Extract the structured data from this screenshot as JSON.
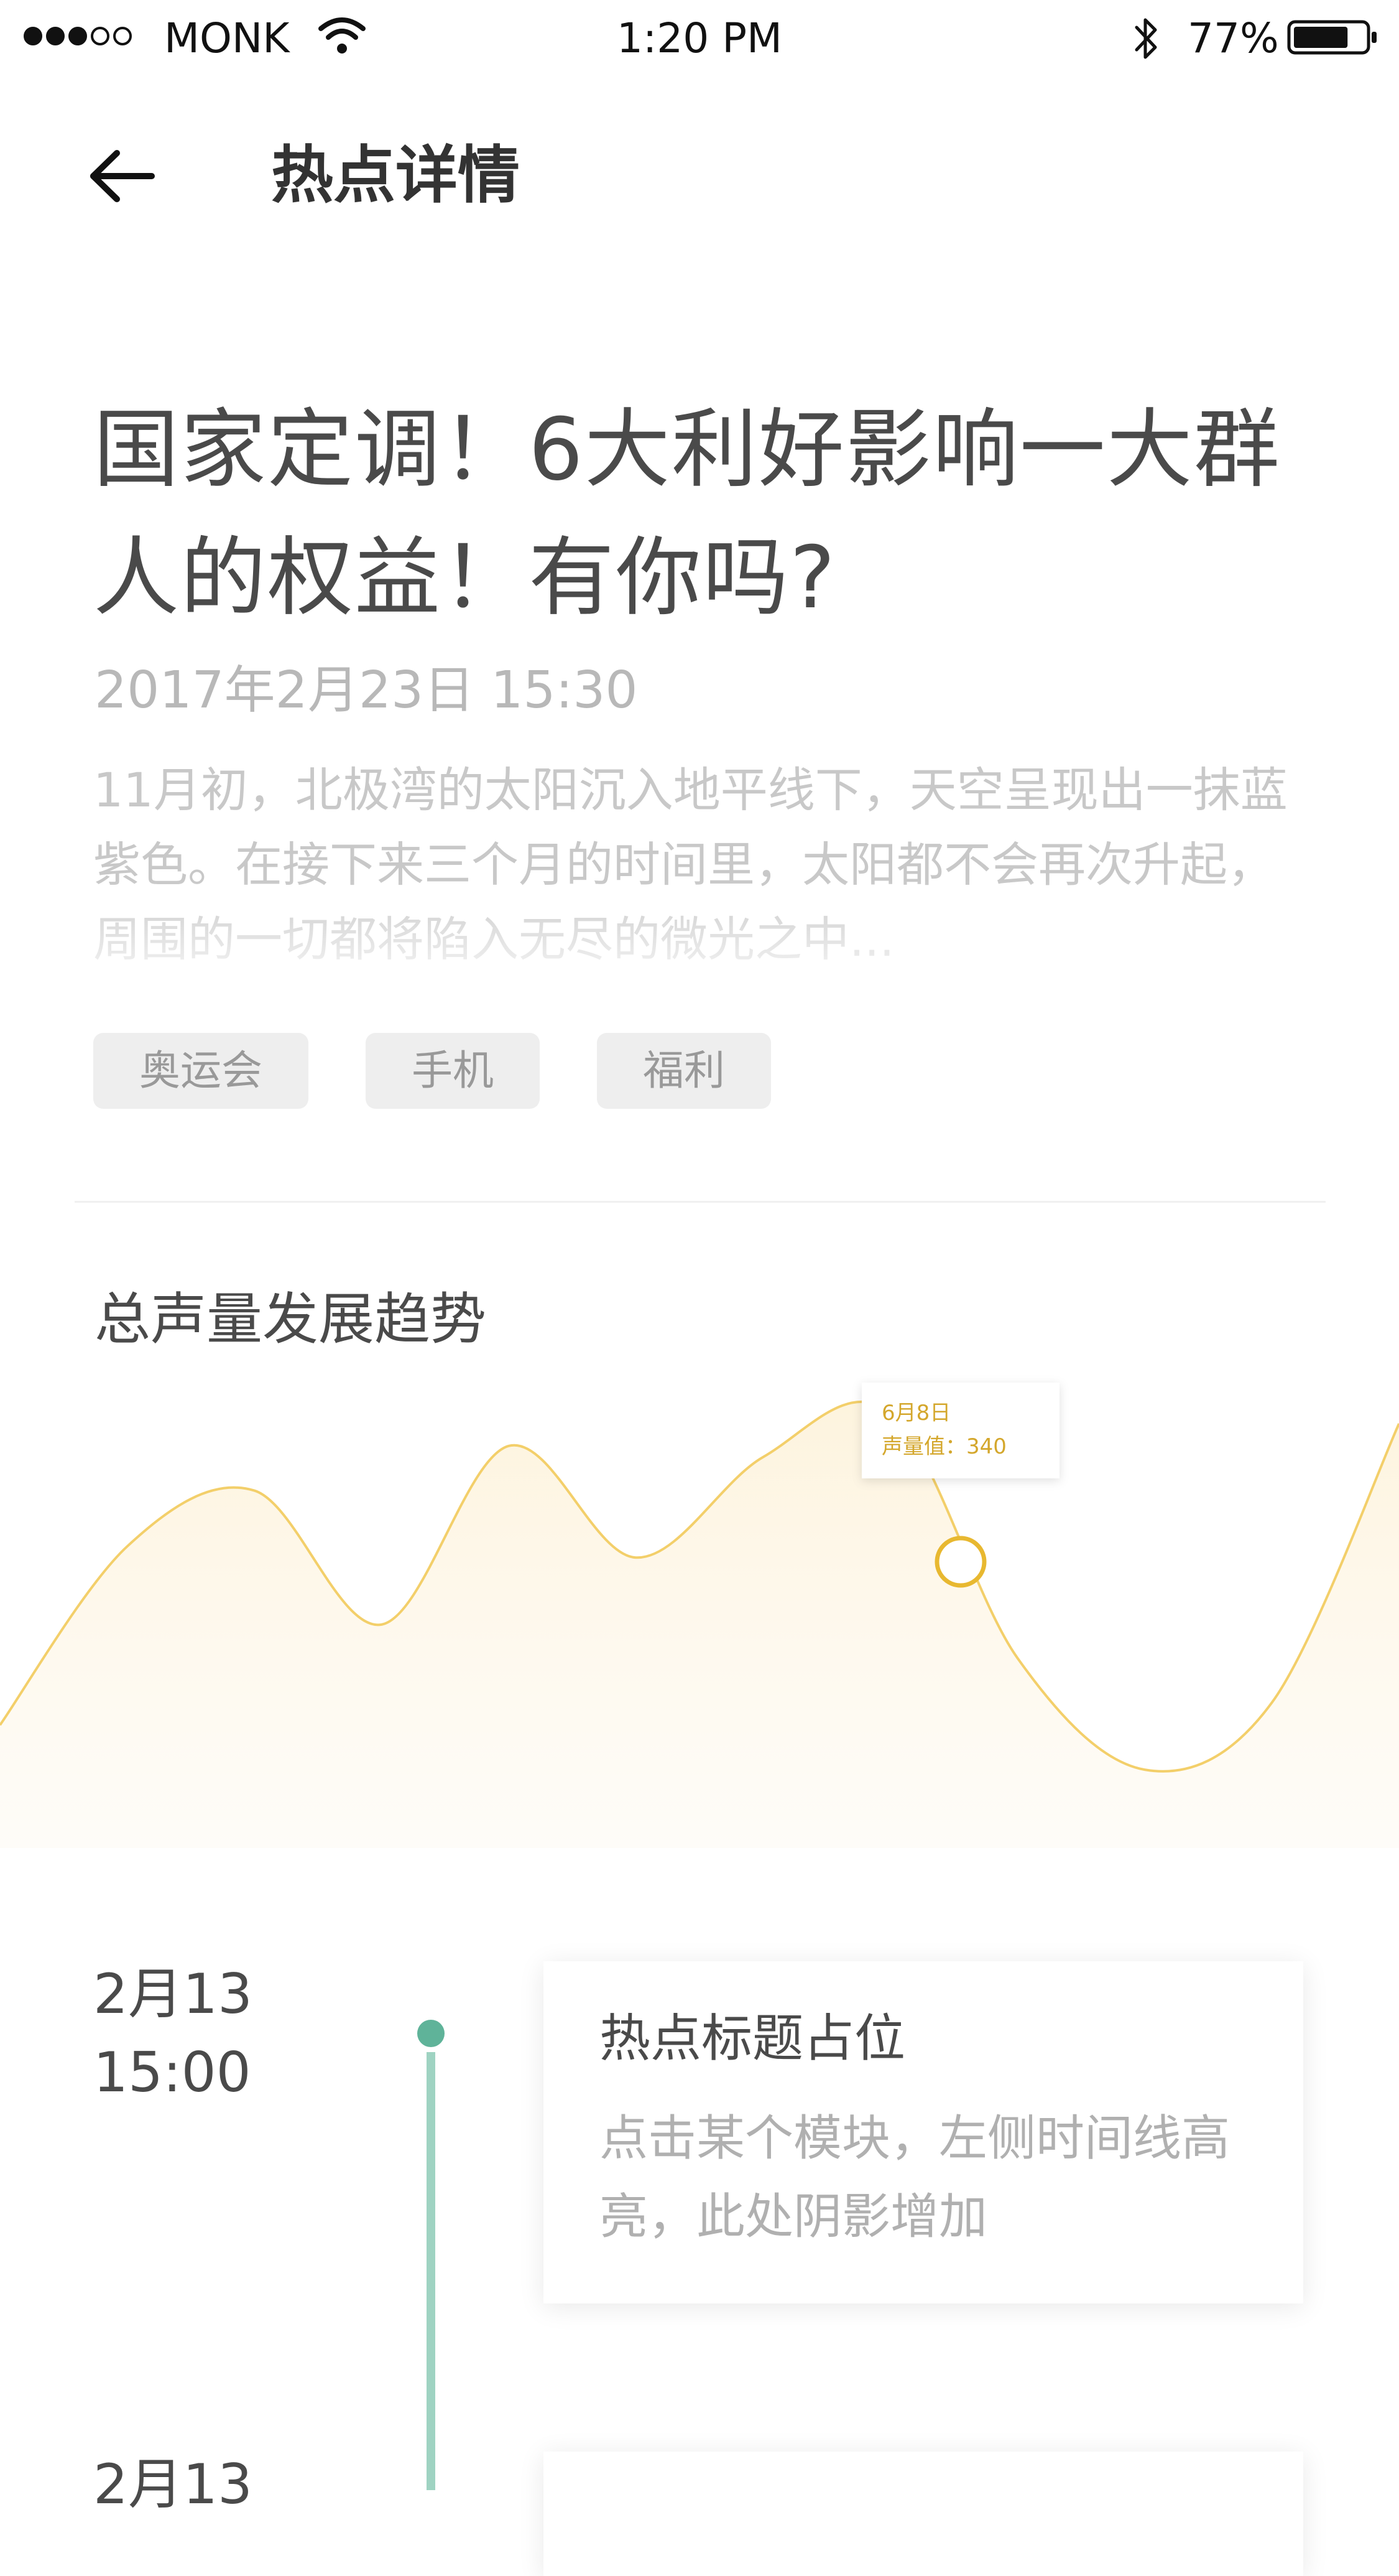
{
  "status_bar": {
    "carrier": "MONK",
    "signal_bars_filled": 3,
    "signal_bars_total": 5,
    "time": "1:20 PM",
    "battery_percent": "77%",
    "battery_level": 0.77
  },
  "nav": {
    "back_icon": "arrow-left-icon",
    "title": "热点详情"
  },
  "article": {
    "title": "国家定调！6大利好影响一大群人的权益！有你吗?",
    "date": "2017年2月23日 15:30",
    "summary": "11月初，北极湾的太阳沉入地平线下，天空呈现出一抹蓝紫色。在接下来三个月的时间里，太阳都不会再次升起，周围的一切都将陷入无尽的微光之中..."
  },
  "tags": [
    "奥运会",
    "手机",
    "福利"
  ],
  "trend": {
    "section_title": "总声量发展趋势",
    "tooltip": {
      "date": "6月8日",
      "value_label": "声量值：340"
    },
    "colors": {
      "line": "#f3cf6a",
      "marker": "#e8b830",
      "tooltip_text": "#d4a72c"
    }
  },
  "chart_data": {
    "type": "area",
    "title": "",
    "xlabel": "",
    "ylabel": "",
    "y": [
      60,
      220,
      270,
      150,
      310,
      210,
      300,
      340,
      120,
      20,
      80,
      330
    ],
    "highlight": {
      "date": "6月8日",
      "value": 340
    }
  },
  "timeline": {
    "items": [
      {
        "date": "2月13",
        "time": "15:00",
        "title": "热点标题占位",
        "desc": "点击某个模块，左侧时间线高亮，此处阴影增加"
      },
      {
        "date": "2月13"
      }
    ],
    "colors": {
      "line": "#9fd3c2",
      "dot": "#5fb399"
    }
  }
}
